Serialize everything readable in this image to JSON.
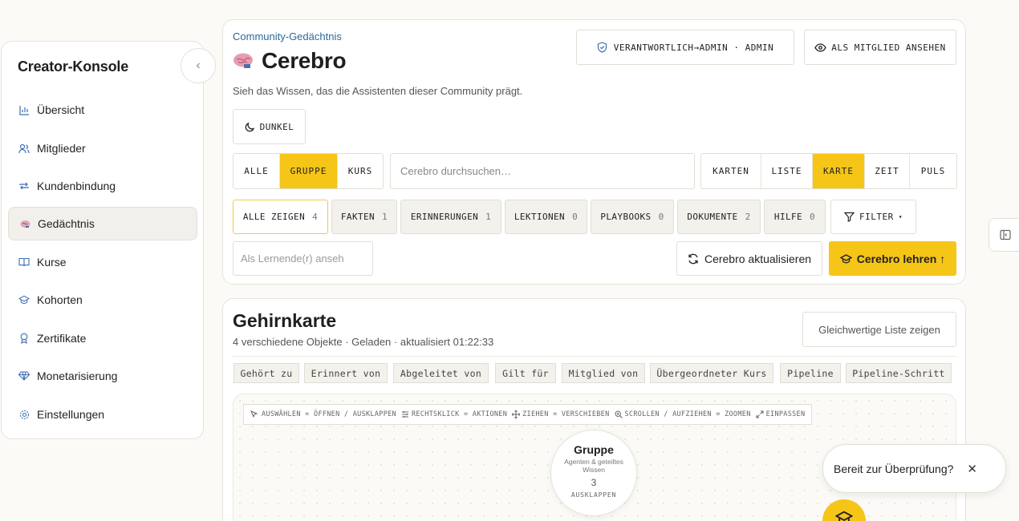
{
  "sidebar": {
    "title": "Creator-Konsole",
    "items": [
      {
        "label": "Übersicht",
        "icon": "bar-chart-icon"
      },
      {
        "label": "Mitglieder",
        "icon": "users-icon"
      },
      {
        "label": "Kundenbindung",
        "icon": "repeat-icon"
      },
      {
        "label": "Gedächtnis",
        "icon": "brain-icon",
        "active": true
      },
      {
        "label": "Kurse",
        "icon": "book-icon"
      },
      {
        "label": "Kohorten",
        "icon": "graduation-cap-icon"
      },
      {
        "label": "Zertifikate",
        "icon": "award-icon"
      },
      {
        "label": "Monetarisierung",
        "icon": "gem-icon"
      },
      {
        "label": "Einstellungen",
        "icon": "gear-icon"
      }
    ]
  },
  "header": {
    "breadcrumb": "Community-Gedächtnis",
    "title": "Cerebro",
    "subtitle": "Sieh das Wissen, das die Assistenten dieser Community prägt.",
    "role_badge": "VERANTWORTLICH→ADMIN · ADMIN",
    "view_as_member": "ALS MITGLIED ANSEHEN",
    "dark_toggle": "DUNKEL"
  },
  "scope_tabs": [
    "ALLE",
    "GRUPPE",
    "KURS"
  ],
  "scope_active": "GRUPPE",
  "search": {
    "placeholder": "Cerebro durchsuchen…"
  },
  "view_tabs": [
    "KARTEN",
    "LISTE",
    "KARTE",
    "ZEIT",
    "PULS"
  ],
  "view_active": "KARTE",
  "filters": [
    {
      "label": "ALLE ZEIGEN",
      "count": "4"
    },
    {
      "label": "FAKTEN",
      "count": "1"
    },
    {
      "label": "ERINNERUNGEN",
      "count": "1"
    },
    {
      "label": "LEKTIONEN",
      "count": "0"
    },
    {
      "label": "PLAYBOOKS",
      "count": "0"
    },
    {
      "label": "DOKUMENTE",
      "count": "2"
    },
    {
      "label": "HILFE",
      "count": "0"
    }
  ],
  "filter_button": "FILTER",
  "learner_input": {
    "placeholder": "Als Lernende(r) anseh"
  },
  "refresh_button": "Cerebro aktualisieren",
  "teach_button": "Cerebro lehren ↑",
  "map": {
    "title": "Gehirnkarte",
    "status": "4 verschiedene Objekte · Geladen · aktualisiert 01:22:33",
    "list_button": "Gleichwertige Liste zeigen",
    "relations": [
      "Gehört zu",
      "Erinnert von",
      "Abgeleitet von",
      "Gilt für",
      "Mitglied von",
      "Übergeordneter Kurs",
      "Pipeline",
      "Pipeline-Schritt"
    ],
    "hints": [
      {
        "icon": "cursor-icon",
        "text": "AUSWÄHLEN = ÖFFNEN / AUSKLAPPEN"
      },
      {
        "icon": "sliders-icon",
        "text": "RECHTSKLICK = AKTIONEN"
      },
      {
        "icon": "move-icon",
        "text": "ZIEHEN = VERSCHIEBEN"
      },
      {
        "icon": "zoom-icon",
        "text": "SCROLLEN / AUFZIEHEN = ZOOMEN"
      },
      {
        "icon": "expand-icon",
        "text": "EINPASSEN"
      }
    ],
    "node": {
      "title": "Gruppe",
      "subtitle": "Agenten & geteiltes Wissen",
      "count": "3",
      "action": "AUSKLAPPEN"
    }
  },
  "toast": {
    "text": "Bereit zur Überprüfung?"
  },
  "colors": {
    "accent": "#f5c518",
    "link": "#2b6a98",
    "icon_blue": "#3d6fb0"
  }
}
